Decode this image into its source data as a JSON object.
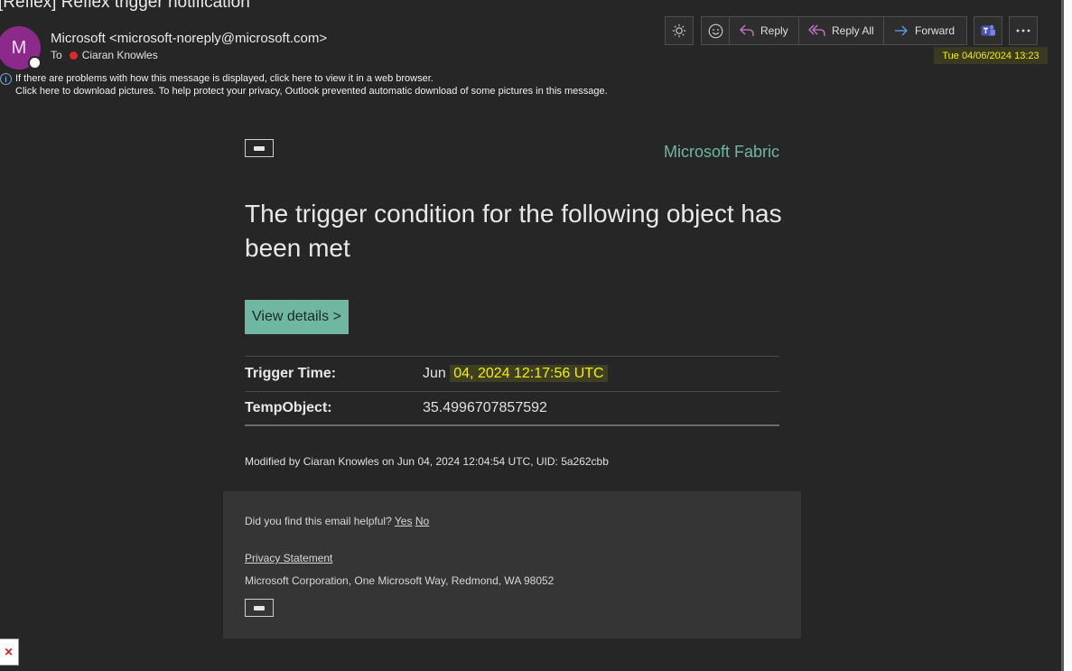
{
  "message": {
    "subject": "[Reflex] Reflex trigger notification",
    "sender": "Microsoft <microsoft-noreply@microsoft.com>",
    "avatar_initial": "M",
    "to_label": "To",
    "recipient": "Ciaran Knowles",
    "datetime": "Tue 04/06/2024 13:23"
  },
  "toolbar": {
    "reply": "Reply",
    "reply_all": "Reply All",
    "forward": "Forward"
  },
  "info": {
    "line1": "If there are problems with how this message is displayed, click here to view it in a web browser.",
    "line2": "Click here to download pictures. To help protect your privacy, Outlook prevented automatic download of some pictures in this message."
  },
  "email": {
    "brand": "Microsoft Fabric",
    "headline": "The trigger condition for the following object has been met",
    "cta": "View details >",
    "rows": [
      {
        "label": "Trigger Time:",
        "value_prefix": "Jun ",
        "value_highlight": "04, 2024 12:17:56 UTC"
      },
      {
        "label": "TempObject:",
        "value": "35.4996707857592"
      }
    ],
    "modified": "Modified by Ciaran Knowles on Jun 04, 2024 12:04:54 UTC, UID: 5a262cbb"
  },
  "footer": {
    "helpful_q": "Did you find this email helpful?",
    "yes": "Yes",
    "no": "No",
    "privacy": "Privacy Statement",
    "address": "Microsoft Corporation, One Microsoft Way, Redmond, WA 98052"
  },
  "colors": {
    "accent": "#6fb7a3",
    "highlight": "#f4f000",
    "avatar": "#8c2a8c"
  }
}
